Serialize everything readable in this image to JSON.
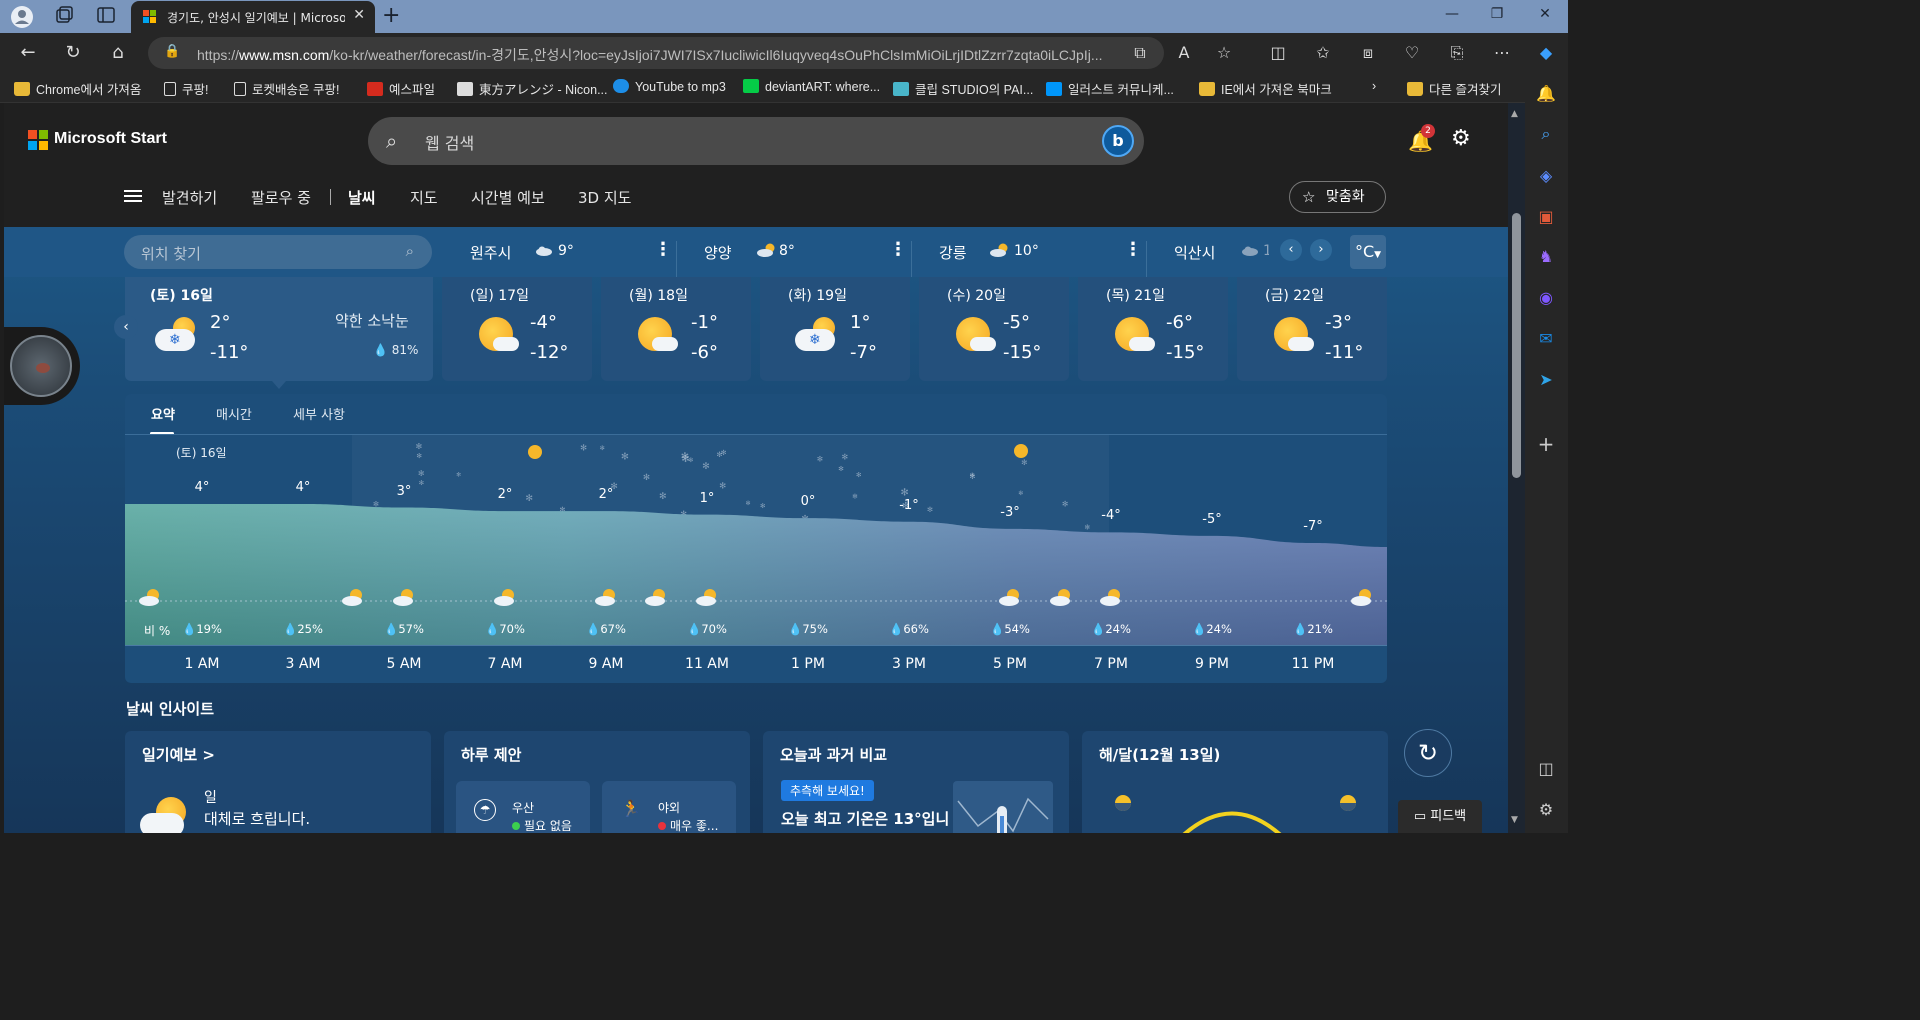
{
  "browser": {
    "tab_title": "경기도, 안성시 일기예보 | Microsoft Start",
    "url_prefix": "https://",
    "url_host": "www.msn.com",
    "url_rest": "/ko-kr/weather/forecast/in-경기도,안성시?loc=eyJsIjoi7JWI7ISx7IucliwicIl6Iuqyveq4sOuPhClsImMiOiLrjIDtlZzrr7zqta0iLCJpIj...",
    "bookmarks": [
      {
        "label": "Chrome에서 가져옴",
        "icon": "folder-icon"
      },
      {
        "label": "쿠팡!",
        "icon": "page-icon"
      },
      {
        "label": "로켓배송은 쿠팡!",
        "icon": "page-icon"
      },
      {
        "label": "예스파일",
        "icon": "yesfile-icon"
      },
      {
        "label": "東方アレンジ - Nicon...",
        "icon": "niconico-icon"
      },
      {
        "label": "YouTube to mp3",
        "icon": "cloud-download-icon"
      },
      {
        "label": "deviantART: where...",
        "icon": "deviantart-icon"
      },
      {
        "label": "클립 STUDIO의 PAI...",
        "icon": "clip-studio-icon"
      },
      {
        "label": "일러스트 커뮤니케...",
        "icon": "pixiv-icon"
      },
      {
        "label": "IE에서 가져온 북마크",
        "icon": "folder-icon"
      }
    ],
    "other_bookmarks": "다른 즐겨찾기"
  },
  "header": {
    "brand": "Microsoft Start",
    "search_placeholder": "웹 검색",
    "notification_count": "2",
    "nav": [
      "발견하기",
      "팔로우 중",
      "날씨",
      "지도",
      "시간별 예보",
      "3D 지도"
    ],
    "personalize": "맞춤화"
  },
  "locations": {
    "search_placeholder": "위치 찾기",
    "cities": [
      {
        "name": "원주시",
        "temp": "9°"
      },
      {
        "name": "양양",
        "temp": "8°"
      },
      {
        "name": "강릉",
        "temp": "10°"
      },
      {
        "name": "익산시",
        "temp": "1"
      }
    ],
    "unit": "°C"
  },
  "daily": [
    {
      "label": "(토) 16일",
      "hi": "2°",
      "lo": "-11°",
      "desc": "약한 소낙눈",
      "precip": "81%",
      "icon": "snow-cloud-sun-icon"
    },
    {
      "label": "(일) 17일",
      "hi": "-4°",
      "lo": "-12°",
      "icon": "sun-cloud-icon"
    },
    {
      "label": "(월) 18일",
      "hi": "-1°",
      "lo": "-6°",
      "icon": "sun-cloud-icon"
    },
    {
      "label": "(화) 19일",
      "hi": "1°",
      "lo": "-7°",
      "icon": "snow-cloud-sun-icon"
    },
    {
      "label": "(수) 20일",
      "hi": "-5°",
      "lo": "-15°",
      "icon": "sun-cloud-icon"
    },
    {
      "label": "(목) 21일",
      "hi": "-6°",
      "lo": "-15°",
      "icon": "sun-cloud-icon"
    },
    {
      "label": "(금) 22일",
      "hi": "-3°",
      "lo": "-11°",
      "icon": "sun-cloud-icon"
    }
  ],
  "chart_tabs": [
    "요약",
    "매시간",
    "세부 사항"
  ],
  "chart_data": {
    "type": "area",
    "day_tag": "(토) 16일",
    "x": [
      "1 AM",
      "3 AM",
      "5 AM",
      "7 AM",
      "9 AM",
      "11 AM",
      "1 PM",
      "3 PM",
      "5 PM",
      "7 PM",
      "9 PM",
      "11 PM"
    ],
    "temperature": [
      4,
      4,
      3,
      2,
      2,
      1,
      0,
      -1,
      -3,
      -4,
      -5,
      -7
    ],
    "temperature_labels": [
      "4°",
      "4°",
      "3°",
      "2°",
      "2°",
      "1°",
      "0°",
      "-1°",
      "-3°",
      "-4°",
      "-5°",
      "-7°"
    ],
    "precip_title": "비 %",
    "precip": [
      "19%",
      "25%",
      "57%",
      "70%",
      "67%",
      "70%",
      "75%",
      "66%",
      "54%",
      "24%",
      "24%",
      "21%"
    ]
  },
  "insights": {
    "title": "날씨 인사이트",
    "forecast_card": {
      "title": "일기예보 >",
      "day": "일",
      "summary": "대체로 흐립니다."
    },
    "suggest_card": {
      "title": "하루 제안",
      "items": [
        {
          "name": "우산",
          "value": "필요 없음",
          "dot": "#3ccf4e"
        },
        {
          "name": "야외",
          "value": "매우 좋...",
          "dot": "#e8323c"
        }
      ]
    },
    "compare_card": {
      "title": "오늘과 과거 비교",
      "badge": "추측해 보세요!",
      "text": "오늘 최고 기온은 13°입니"
    },
    "sun_card": {
      "title": "해/달(12월 13일)"
    }
  },
  "feedback": "피드백"
}
